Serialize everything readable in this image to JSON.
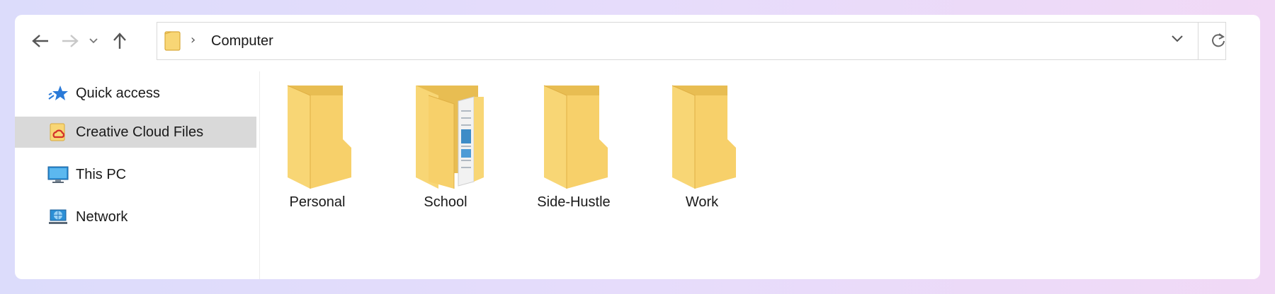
{
  "toolbar": {
    "back_icon": "arrow-left-icon",
    "forward_icon": "arrow-right-icon",
    "recent_icon": "chevron-down-icon",
    "up_icon": "arrow-up-icon"
  },
  "address_bar": {
    "path": "Computer",
    "separator": "›",
    "folder_icon": "folder-icon",
    "dropdown_icon": "chevron-down-icon",
    "refresh_icon": "refresh-icon"
  },
  "sidebar": {
    "items": [
      {
        "label": "Quick access",
        "icon": "star-icon",
        "selected": false
      },
      {
        "label": "Creative Cloud Files",
        "icon": "creative-cloud-folder-icon",
        "selected": true
      },
      {
        "label": "This PC",
        "icon": "monitor-icon",
        "selected": false
      },
      {
        "label": "Network",
        "icon": "network-icon",
        "selected": false
      }
    ]
  },
  "folders": [
    {
      "name": "Personal",
      "icon": "folder-icon"
    },
    {
      "name": "School",
      "icon": "folder-with-documents-icon"
    },
    {
      "name": "Side-Hustle",
      "icon": "folder-icon"
    },
    {
      "name": "Work",
      "icon": "folder-icon"
    }
  ],
  "colors": {
    "folder_back": "#e8bd52",
    "folder_front": "#f8d675",
    "selection": "#d9d9d9",
    "star": "#2a7ad8"
  }
}
